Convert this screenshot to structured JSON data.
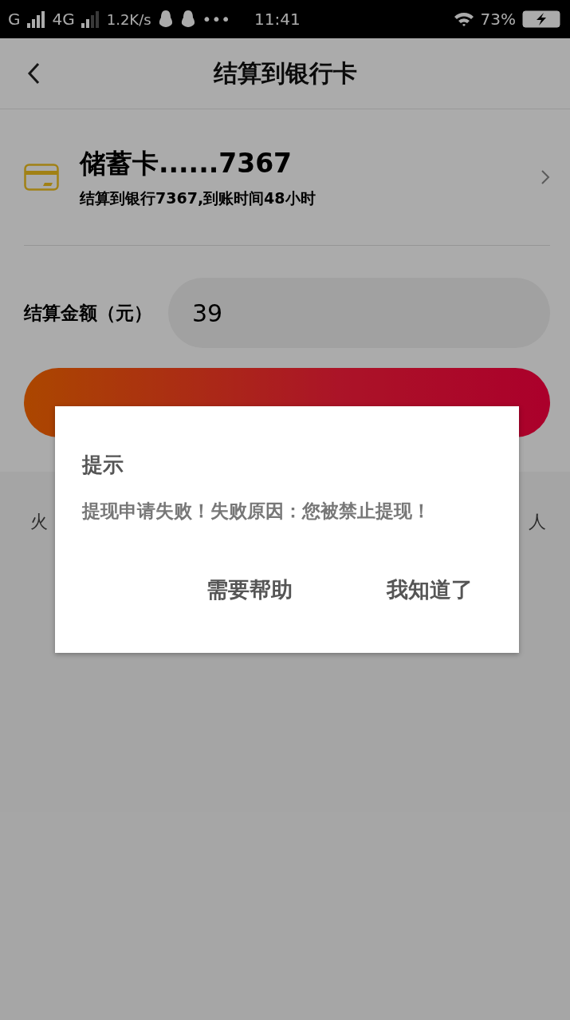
{
  "status_bar": {
    "network_1": "G",
    "network_2": "4G",
    "speed": "1.2K/s",
    "more": "•••",
    "time": "11:41",
    "battery": "73%"
  },
  "header": {
    "title": "结算到银行卡"
  },
  "card": {
    "name": "储蓄卡......7367",
    "detail": "结算到银行7367,到账时间48小时"
  },
  "amount": {
    "label": "结算金额（元）",
    "value": "39"
  },
  "notice": {
    "start": "火",
    "end": "人"
  },
  "dialog": {
    "title": "提示",
    "message": "提现申请失败！失败原因：您被禁止提现！",
    "buttons": [
      {
        "label": "需要帮助"
      },
      {
        "label": "我知道了"
      }
    ]
  }
}
